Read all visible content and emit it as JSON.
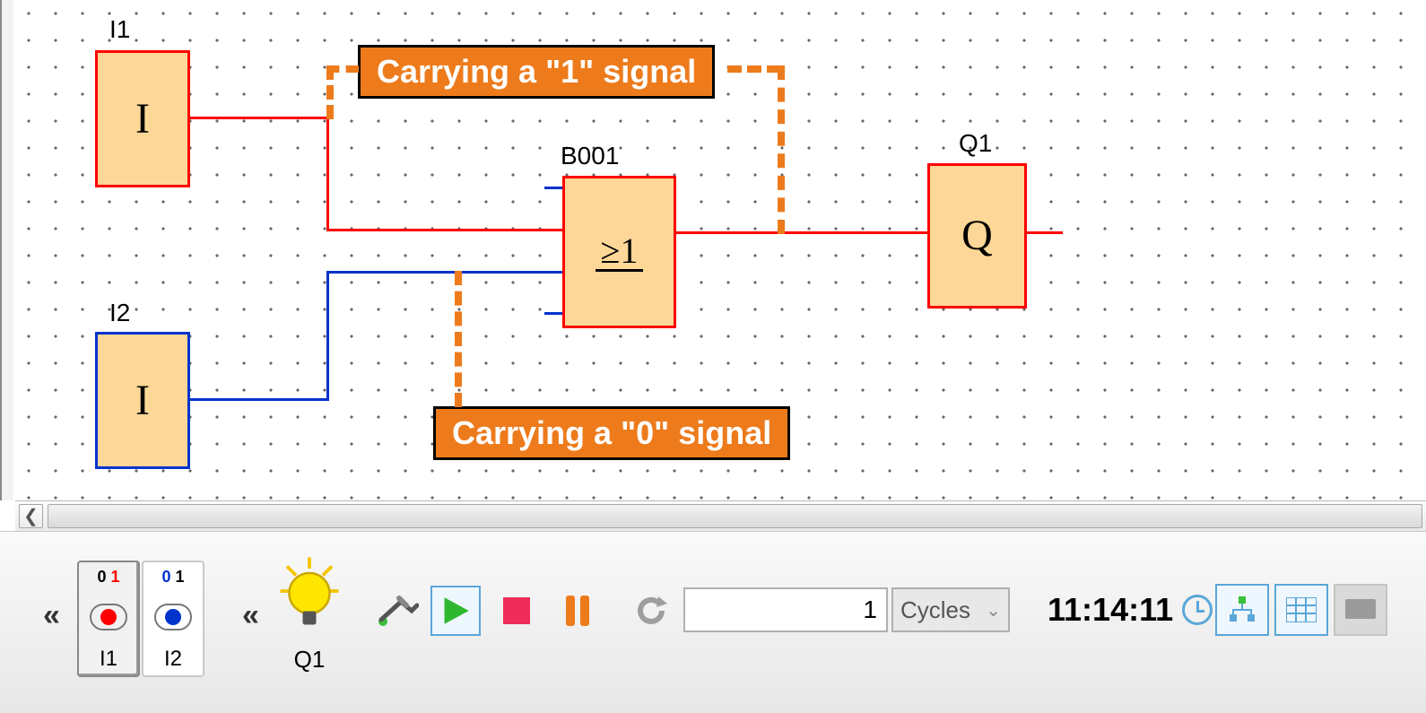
{
  "blocks": {
    "i1": {
      "label": "I1",
      "symbol": "I",
      "state": 1
    },
    "i2": {
      "label": "I2",
      "symbol": "I",
      "state": 0
    },
    "b001": {
      "label": "B001",
      "symbol": "≥1"
    },
    "q1": {
      "label": "Q1",
      "symbol": "Q",
      "state": 1
    }
  },
  "callouts": {
    "signal1": "Carrying a \"1\" signal",
    "signal0": "Carrying a \"0\" signal"
  },
  "sim": {
    "toggles": {
      "i1": {
        "bits": [
          "0",
          "1"
        ],
        "active_bit": 1,
        "label": "I1"
      },
      "i2": {
        "bits": [
          "0",
          "1"
        ],
        "active_bit": 0,
        "label": "I2"
      }
    },
    "output": {
      "label": "Q1",
      "lit": true
    },
    "cycles_value": "1",
    "cycles_label": "Cycles",
    "time": "11:14:11"
  }
}
